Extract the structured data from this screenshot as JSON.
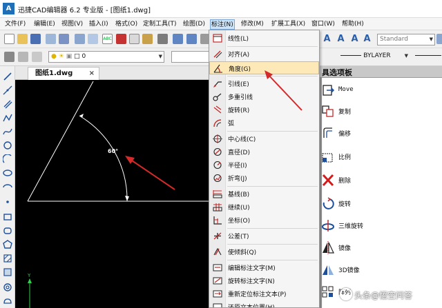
{
  "window": {
    "title": "迅捷CAD编辑器 6.2 专业版 - [图纸1.dwg]",
    "logo": "A"
  },
  "menubar": [
    {
      "label": "文件(F)",
      "active": false
    },
    {
      "label": "编辑(E)",
      "active": false
    },
    {
      "label": "视图(V)",
      "active": false
    },
    {
      "label": "插入(I)",
      "active": false
    },
    {
      "label": "格式(O)",
      "active": false
    },
    {
      "label": "定制工具(T)",
      "active": false
    },
    {
      "label": "绘图(D)",
      "active": false
    },
    {
      "label": "标注(N)",
      "active": true
    },
    {
      "label": "修改(M)",
      "active": false
    },
    {
      "label": "扩展工具(X)",
      "active": false
    },
    {
      "label": "窗口(W)",
      "active": false
    },
    {
      "label": "帮助(H)",
      "active": false
    }
  ],
  "toolbar": {
    "text_style": "Standard",
    "layer_value": "0",
    "linetype_value": "BYLAYER"
  },
  "document_tab": {
    "label": "图纸1.dwg",
    "close": "×"
  },
  "drawing": {
    "angle_label": "60°",
    "axis_label": "Y"
  },
  "dimension_menu": [
    {
      "label": "线性(L)",
      "icon": "linear-dim-icon",
      "highlighted": false
    },
    {
      "label": "对齐(A)",
      "icon": "aligned-dim-icon",
      "highlighted": false
    },
    {
      "label": "角度(G)",
      "icon": "angular-dim-icon",
      "highlighted": true
    },
    {
      "label": "引线(E)",
      "icon": "leader-icon",
      "highlighted": false
    },
    {
      "label": "多重引线",
      "icon": "multileader-icon",
      "highlighted": false
    },
    {
      "label": "旋转(R)",
      "icon": "rotated-dim-icon",
      "highlighted": false
    },
    {
      "label": "弧",
      "icon": "arc-dim-icon",
      "highlighted": false
    },
    {
      "label": "中心线(C)",
      "icon": "center-mark-icon",
      "highlighted": false
    },
    {
      "label": "直径(D)",
      "icon": "diameter-dim-icon",
      "highlighted": false
    },
    {
      "label": "半径(I)",
      "icon": "radius-dim-icon",
      "highlighted": false
    },
    {
      "label": "折弯(J)",
      "icon": "jogged-dim-icon",
      "highlighted": false
    },
    {
      "label": "基线(B)",
      "icon": "baseline-dim-icon",
      "highlighted": false
    },
    {
      "label": "继续(U)",
      "icon": "continue-dim-icon",
      "highlighted": false
    },
    {
      "label": "坐标(O)",
      "icon": "ordinate-dim-icon",
      "highlighted": false
    },
    {
      "label": "公差(T)",
      "icon": "tolerance-icon",
      "highlighted": false
    },
    {
      "label": "使倾斜(Q)",
      "icon": "oblique-icon",
      "highlighted": false
    },
    {
      "label": "编辑标注文字(M)",
      "icon": "edit-dim-text-icon",
      "highlighted": false
    },
    {
      "label": "旋转标注文字(N)",
      "icon": "rotate-dim-text-icon",
      "highlighted": false
    },
    {
      "label": "重新定位标注文本(P)",
      "icon": "reposition-dim-text-icon",
      "highlighted": false
    },
    {
      "label": "还原文本位置(H)",
      "icon": "restore-text-icon",
      "highlighted": false
    }
  ],
  "palette": {
    "title": "具选项板",
    "items": [
      {
        "label": "Move",
        "icon": "move-icon"
      },
      {
        "label": "复制",
        "icon": "copy-icon"
      },
      {
        "label": "偏移",
        "icon": "offset-icon"
      },
      {
        "label": "比例",
        "icon": "scale-icon"
      },
      {
        "label": "删除",
        "icon": "delete-icon"
      },
      {
        "label": "旋转",
        "icon": "rotate-icon"
      },
      {
        "label": "三维旋转",
        "icon": "rotate-3d-icon"
      },
      {
        "label": "镜像",
        "icon": "mirror-icon"
      },
      {
        "label": "3D镜像",
        "icon": "mirror-3d-icon"
      },
      {
        "label": "阵列",
        "icon": "array-icon"
      }
    ]
  },
  "watermark": {
    "text": "头条@悟空问答"
  },
  "colors": {
    "annotation_arrow": "#d42a2a",
    "menu_highlight": "#fde9b8",
    "canvas_bg": "#000000"
  }
}
